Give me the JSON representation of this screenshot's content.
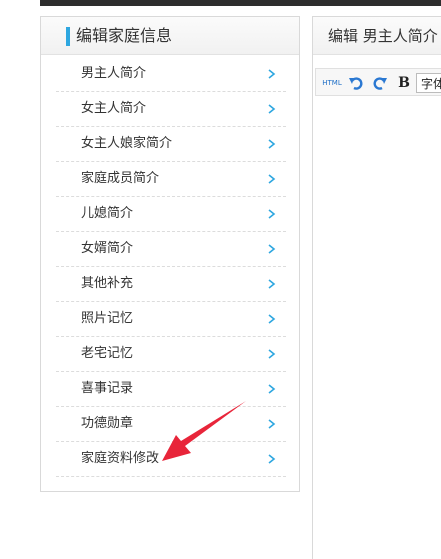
{
  "sidebar": {
    "title": "编辑家庭信息",
    "items": [
      {
        "label": "男主人简介"
      },
      {
        "label": "女主人简介"
      },
      {
        "label": "女主人娘家简介"
      },
      {
        "label": "家庭成员简介"
      },
      {
        "label": "儿媳简介"
      },
      {
        "label": "女婿简介"
      },
      {
        "label": "其他补充"
      },
      {
        "label": "照片记忆"
      },
      {
        "label": "老宅记忆"
      },
      {
        "label": "喜事记录"
      },
      {
        "label": "功德勋章"
      },
      {
        "label": "家庭资料修改"
      }
    ]
  },
  "editor": {
    "title": "编辑 男主人简介",
    "toolbar": {
      "html_label": "HTML",
      "bold_label": "B",
      "font_label": "字体"
    }
  },
  "colors": {
    "accent": "#2ea7e0",
    "annotation_arrow": "#e8253a"
  }
}
